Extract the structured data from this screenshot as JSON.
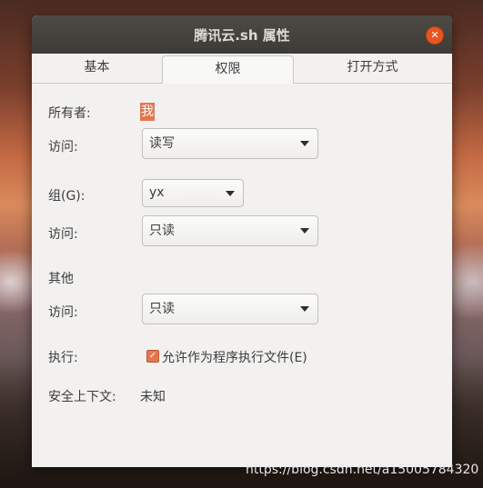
{
  "window": {
    "title": "腾讯云.sh 属性"
  },
  "tabs": [
    {
      "label": "基本"
    },
    {
      "label": "权限"
    },
    {
      "label": "打开方式"
    }
  ],
  "permissions": {
    "owner_label": "所有者:",
    "owner_value": "我",
    "owner_access_label": "访问:",
    "owner_access_value": "读写",
    "group_label": "组(G):",
    "group_value": "yx",
    "group_access_label": "访问:",
    "group_access_value": "只读",
    "others_label": "其他",
    "others_access_label": "访问:",
    "others_access_value": "只读",
    "execute_label": "执行:",
    "execute_checkbox_label": "允许作为程序执行文件(E)",
    "execute_checked": true,
    "security_context_label": "安全上下文:",
    "security_context_value": "未知"
  },
  "watermark": "https://blog.csdn.net/a15005784320",
  "colors": {
    "accent": "#e2774f",
    "close": "#e95420",
    "titlebar": "#3d3b37"
  }
}
